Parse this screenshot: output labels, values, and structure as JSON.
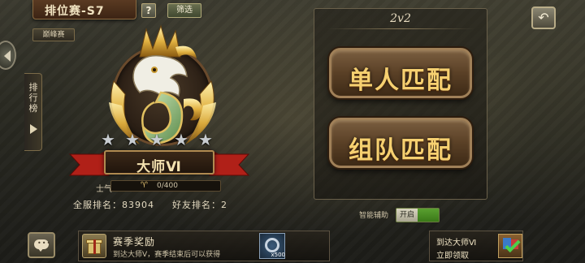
{
  "header": {
    "title": "排位赛-S7",
    "help_label": "?",
    "filter_label": "筛选",
    "peak_label": "巅峰赛",
    "back_icon": "back-arrow-icon"
  },
  "sidebar": {
    "ranking_label": "排行榜"
  },
  "profile": {
    "rank_name": "大师Ⅵ",
    "stars_filled": 0,
    "stars_total": 5,
    "morale_label": "士气",
    "morale_value": 0,
    "morale_max": 400,
    "morale_text": "0/400",
    "server_rank_label": "全服排名：",
    "server_rank_value": "83904",
    "friend_rank_label": "好友排名：",
    "friend_rank_value": "2"
  },
  "match": {
    "mode_title": "2v2",
    "single_label": "单人匹配",
    "team_label": "组队匹配"
  },
  "assist": {
    "label": "智能辅助",
    "state_label": "开启"
  },
  "reward": {
    "title": "赛季奖励",
    "description": "到达大师Ⅴ，赛季结束后可以获得",
    "item_qty": "x500"
  },
  "master_reward": {
    "line1": "到达大师Ⅵ",
    "line2": "立即领取"
  },
  "colors": {
    "gold": "#f6d070",
    "accent_green": "#5aa030",
    "banner_red": "#b02018"
  }
}
